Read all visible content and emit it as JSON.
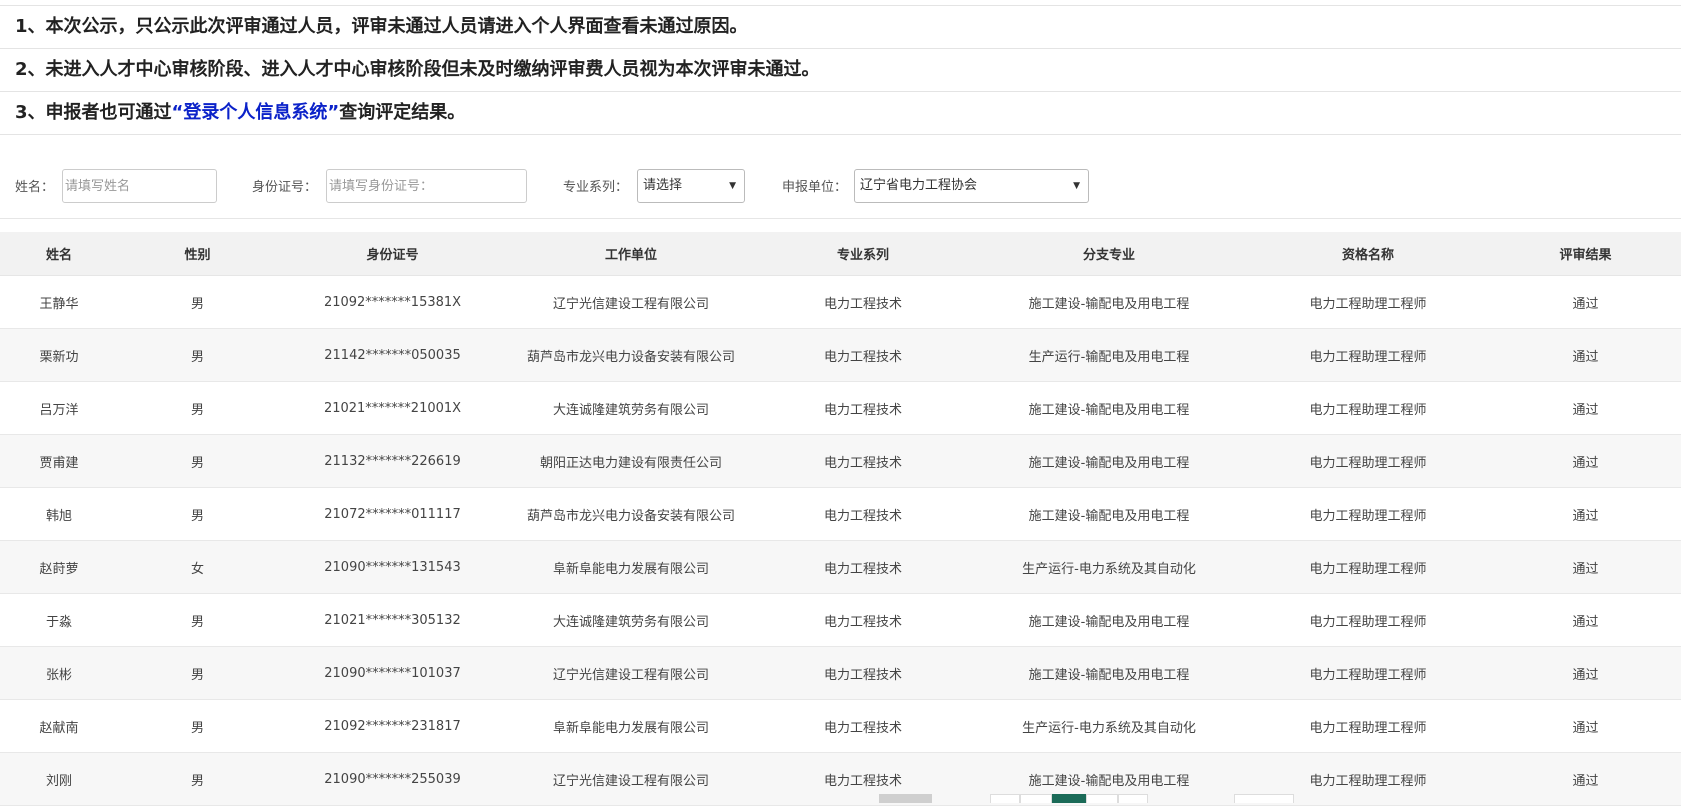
{
  "notices": [
    "1、本次公示，只公示此次评审通过人员，评审未通过人员请进入个人界面查看未通过原因。",
    "2、未进入人才中心审核阶段、进入人才中心审核阶段但未及时缴纳评审费人员视为本次评审未通过。"
  ],
  "notice3": {
    "prefix": "3、申报者也可通过",
    "link": "“登录个人信息系统”",
    "suffix": "查询评定结果。"
  },
  "filters": {
    "name_label": "姓名：",
    "name_placeholder": "请填写姓名",
    "id_label": "身份证号：",
    "id_placeholder": "请填写身份证号：",
    "major_label": "专业系列：",
    "major_value": "请选择",
    "unit_label": "申报单位：",
    "unit_value": "辽宁省电力工程协会"
  },
  "table": {
    "headers": [
      "姓名",
      "性别",
      "身份证号",
      "工作单位",
      "专业系列",
      "分支专业",
      "资格名称",
      "评审结果"
    ],
    "rows": [
      [
        "王静华",
        "男",
        "21092*******15381X",
        "辽宁光信建设工程有限公司",
        "电力工程技术",
        "施工建设-输配电及用电工程",
        "电力工程助理工程师",
        "通过"
      ],
      [
        "栗新功",
        "男",
        "21142*******050035",
        "葫芦岛市龙兴电力设备安装有限公司",
        "电力工程技术",
        "生产运行-输配电及用电工程",
        "电力工程助理工程师",
        "通过"
      ],
      [
        "吕万洋",
        "男",
        "21021*******21001X",
        "大连诚隆建筑劳务有限公司",
        "电力工程技术",
        "施工建设-输配电及用电工程",
        "电力工程助理工程师",
        "通过"
      ],
      [
        "贾甫建",
        "男",
        "21132*******226619",
        "朝阳正达电力建设有限责任公司",
        "电力工程技术",
        "施工建设-输配电及用电工程",
        "电力工程助理工程师",
        "通过"
      ],
      [
        "韩旭",
        "男",
        "21072*******011117",
        "葫芦岛市龙兴电力设备安装有限公司",
        "电力工程技术",
        "施工建设-输配电及用电工程",
        "电力工程助理工程师",
        "通过"
      ],
      [
        "赵莳萝",
        "女",
        "21090*******131543",
        "阜新阜能电力发展有限公司",
        "电力工程技术",
        "生产运行-电力系统及其自动化",
        "电力工程助理工程师",
        "通过"
      ],
      [
        "于淼",
        "男",
        "21021*******305132",
        "大连诚隆建筑劳务有限公司",
        "电力工程技术",
        "施工建设-输配电及用电工程",
        "电力工程助理工程师",
        "通过"
      ],
      [
        "张彬",
        "男",
        "21090*******101037",
        "辽宁光信建设工程有限公司",
        "电力工程技术",
        "施工建设-输配电及用电工程",
        "电力工程助理工程师",
        "通过"
      ],
      [
        "赵献南",
        "男",
        "21092*******231817",
        "阜新阜能电力发展有限公司",
        "电力工程技术",
        "生产运行-电力系统及其自动化",
        "电力工程助理工程师",
        "通过"
      ],
      [
        "刘刚",
        "男",
        "21090*******255039",
        "辽宁光信建设工程有限公司",
        "电力工程技术",
        "施工建设-输配电及用电工程",
        "电力工程助理工程师",
        "通过"
      ]
    ]
  },
  "colors": {
    "link": "#0b22c9",
    "active_page": "#1b6b58",
    "header_bg": "#f2f2f2"
  }
}
